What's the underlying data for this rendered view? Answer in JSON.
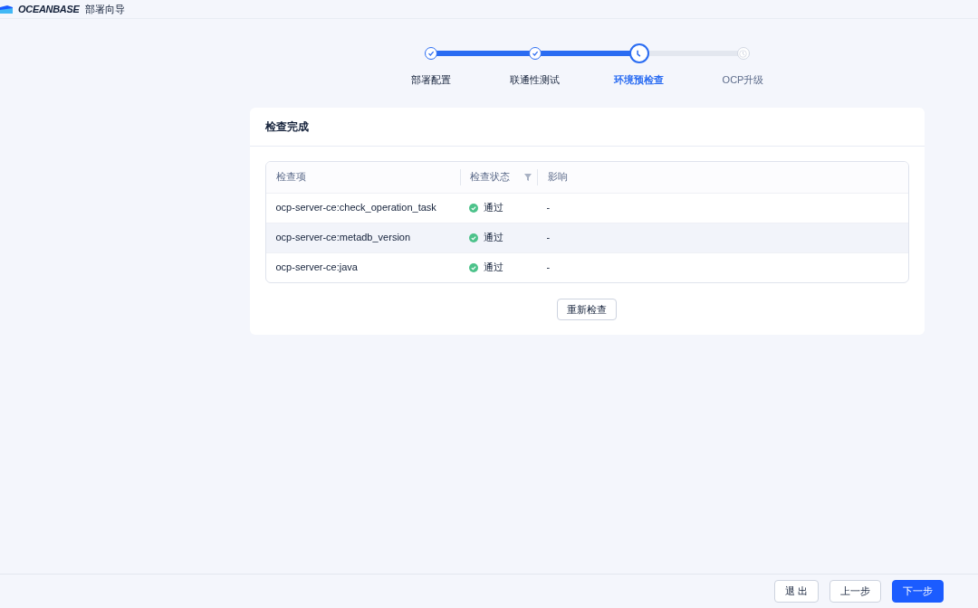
{
  "header": {
    "logo": "OCEANBASE",
    "title": "部署向导"
  },
  "steps": [
    {
      "label": "部署配置",
      "done": true,
      "current": false
    },
    {
      "label": "联通性测试",
      "done": true,
      "current": false
    },
    {
      "label": "环境预检查",
      "done": false,
      "current": true
    },
    {
      "label": "OCP升级",
      "done": false,
      "current": false
    }
  ],
  "card": {
    "title": "检查完成",
    "table": {
      "columns": [
        {
          "label": "检查项",
          "filter": false
        },
        {
          "label": "检查状态",
          "filter": true
        },
        {
          "label": "影响",
          "filter": false
        }
      ],
      "rows": [
        {
          "item": "ocp-server-ce:check_operation_task",
          "status": "通过",
          "passed": true,
          "impact": "-",
          "highlighted": false
        },
        {
          "item": "ocp-server-ce:metadb_version",
          "status": "通过",
          "passed": true,
          "impact": "-",
          "highlighted": true
        },
        {
          "item": "ocp-server-ce:java",
          "status": "通过",
          "passed": true,
          "impact": "-",
          "highlighted": false
        }
      ]
    },
    "recheck_button": "重新检查"
  },
  "footer": {
    "buttons": [
      {
        "label": "退 出",
        "primary": false
      },
      {
        "label": "上一步",
        "primary": false
      },
      {
        "label": "下一步",
        "primary": true
      }
    ]
  }
}
